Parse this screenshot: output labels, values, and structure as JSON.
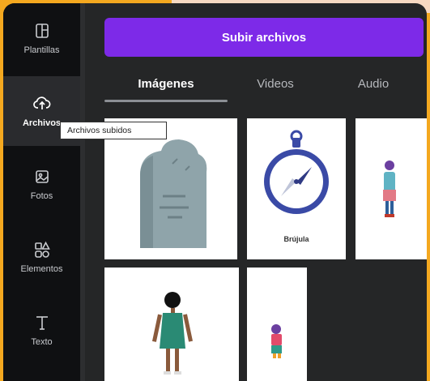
{
  "upload_button": {
    "label": "Subir archivos"
  },
  "sidebar": {
    "items": [
      {
        "label": "Plantillas",
        "icon": "templates-icon"
      },
      {
        "label": "Archivos",
        "icon": "cloud-upload-icon"
      },
      {
        "label": "Fotos",
        "icon": "photo-icon"
      },
      {
        "label": "Elementos",
        "icon": "shapes-icon"
      },
      {
        "label": "Texto",
        "icon": "text-icon"
      }
    ]
  },
  "tooltip": {
    "text": "Archivos subidos"
  },
  "tabs": [
    {
      "label": "Imágenes"
    },
    {
      "label": "Videos"
    },
    {
      "label": "Audio"
    }
  ],
  "media": {
    "items": [
      {
        "name": "gravestone-image"
      },
      {
        "name": "compass-image",
        "caption": "Brújula"
      },
      {
        "name": "girl-character-image"
      },
      {
        "name": "woman-character-image"
      },
      {
        "name": "small-character-image"
      }
    ]
  },
  "colors": {
    "accent": "#7d2ae8",
    "sidebar": "#0f1012",
    "panel": "#252627"
  }
}
